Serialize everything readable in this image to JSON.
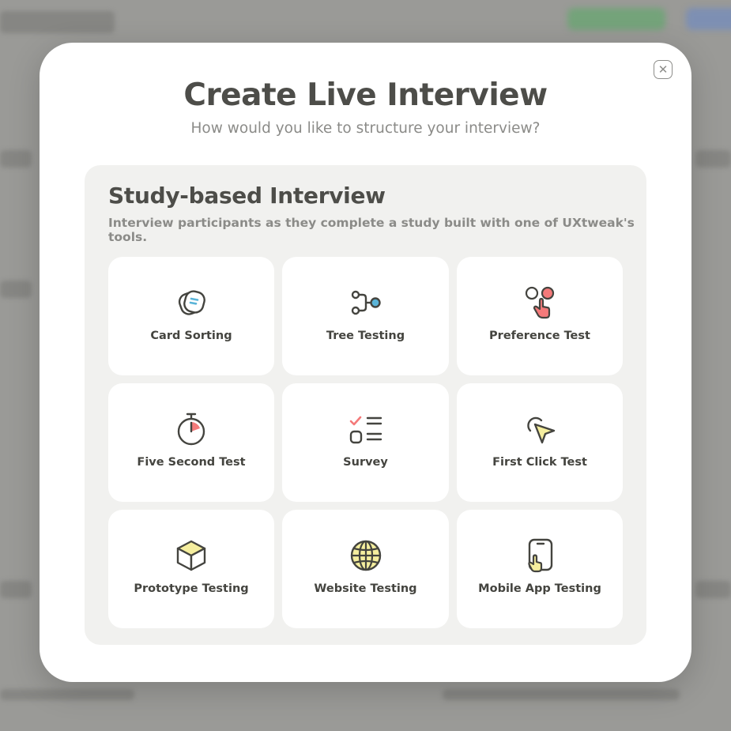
{
  "modal": {
    "title": "Create Live Interview",
    "subtitle": "How would you like to structure your interview?",
    "close_icon": "close-icon",
    "close_glyph": "✕"
  },
  "section": {
    "title": "Study-based Interview",
    "description": "Interview participants as they complete a study built with one of UXtweak's tools.",
    "options": [
      {
        "label": "Card Sorting",
        "icon": "card-sorting-icon"
      },
      {
        "label": "Tree Testing",
        "icon": "tree-testing-icon"
      },
      {
        "label": "Preference Test",
        "icon": "preference-test-icon"
      },
      {
        "label": "Five Second Test",
        "icon": "stopwatch-icon"
      },
      {
        "label": "Survey",
        "icon": "survey-checklist-icon"
      },
      {
        "label": "First Click Test",
        "icon": "cursor-click-icon"
      },
      {
        "label": "Prototype Testing",
        "icon": "cube-icon"
      },
      {
        "label": "Website Testing",
        "icon": "globe-icon"
      },
      {
        "label": "Mobile App Testing",
        "icon": "mobile-tap-icon"
      }
    ]
  },
  "colors": {
    "accent_blue": "#5ab4d8",
    "accent_red": "#f47a7a",
    "accent_yellow": "#f5ee9e",
    "text_dark": "#4d4d49",
    "text_muted": "#8b8b88",
    "panel_bg": "#f1f1ef"
  }
}
